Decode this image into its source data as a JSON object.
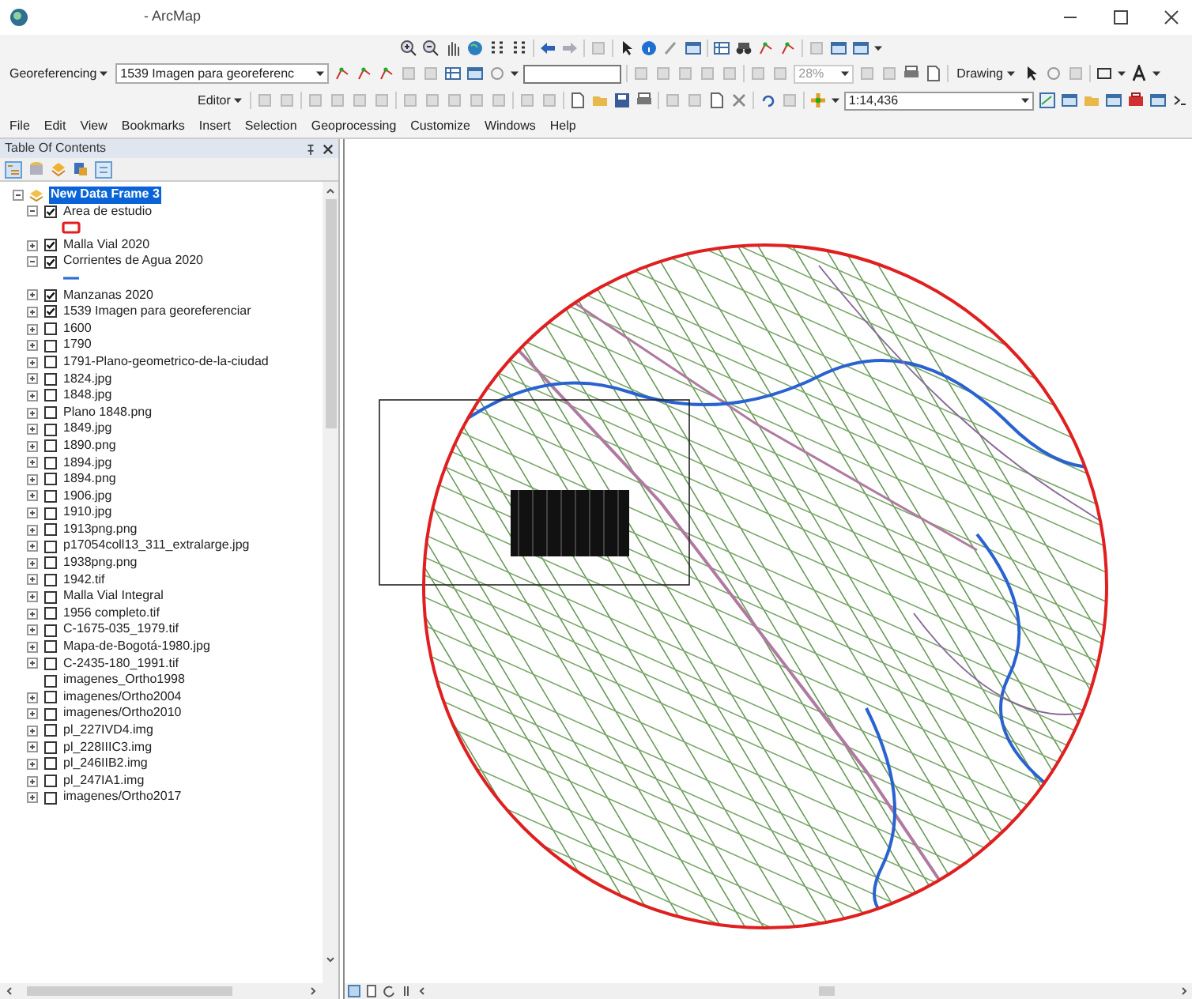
{
  "window": {
    "title": "- ArcMap"
  },
  "toolbars": {
    "georeferencing": {
      "label": "Georeferencing",
      "layer": "1539 Imagen para georeferenc",
      "zoom": "28%"
    },
    "drawing": {
      "label": "Drawing"
    },
    "editor": {
      "label": "Editor"
    },
    "scale": "1:14,436"
  },
  "menu": [
    "File",
    "Edit",
    "View",
    "Bookmarks",
    "Insert",
    "Selection",
    "Geoprocessing",
    "Customize",
    "Windows",
    "Help"
  ],
  "toc": {
    "title": "Table Of Contents",
    "data_frame": {
      "label": "New Data Frame 3",
      "selected": true,
      "expanded": true
    },
    "layers": [
      {
        "label": "Area de estudio",
        "checked": true,
        "expanded": true,
        "legend": {
          "kind": "outline",
          "color": "#e02020"
        }
      },
      {
        "label": "Malla Vial 2020",
        "checked": true,
        "expanded": false
      },
      {
        "label": "Corrientes de Agua 2020",
        "checked": true,
        "expanded": true,
        "legend": {
          "kind": "line",
          "color": "#2a6fd6"
        }
      },
      {
        "label": "Manzanas 2020",
        "checked": true,
        "expanded": false
      },
      {
        "label": "1539 Imagen para georeferenciar",
        "checked": true,
        "expanded": false
      },
      {
        "label": "1600",
        "checked": false,
        "expanded": false
      },
      {
        "label": "1790",
        "checked": false,
        "expanded": false
      },
      {
        "label": "1791-Plano-geometrico-de-la-ciudad",
        "checked": false,
        "expanded": false
      },
      {
        "label": "1824.jpg",
        "checked": false,
        "expanded": false
      },
      {
        "label": "1848.jpg",
        "checked": false,
        "expanded": false
      },
      {
        "label": "Plano 1848.png",
        "checked": false,
        "expanded": false
      },
      {
        "label": "1849.jpg",
        "checked": false,
        "expanded": false
      },
      {
        "label": "1890.png",
        "checked": false,
        "expanded": false
      },
      {
        "label": "1894.jpg",
        "checked": false,
        "expanded": false
      },
      {
        "label": "1894.png",
        "checked": false,
        "expanded": false
      },
      {
        "label": "1906.jpg",
        "checked": false,
        "expanded": false
      },
      {
        "label": "1910.jpg",
        "checked": false,
        "expanded": false
      },
      {
        "label": "1913png.png",
        "checked": false,
        "expanded": false
      },
      {
        "label": "p17054coll13_311_extralarge.jpg",
        "checked": false,
        "expanded": false
      },
      {
        "label": "1938png.png",
        "checked": false,
        "expanded": false
      },
      {
        "label": "1942.tif",
        "checked": false,
        "expanded": false
      },
      {
        "label": "Malla Vial Integral",
        "checked": false,
        "expanded": false
      },
      {
        "label": "1956 completo.tif",
        "checked": false,
        "expanded": false
      },
      {
        "label": "C-1675-035_1979.tif",
        "checked": false,
        "expanded": false
      },
      {
        "label": "Mapa-de-Bogotá-1980.jpg",
        "checked": false,
        "expanded": false
      },
      {
        "label": "C-2435-180_1991.tif",
        "checked": false,
        "expanded": false
      },
      {
        "label": "imagenes_Ortho1998",
        "checked": false
      },
      {
        "label": "imagenes/Ortho2004",
        "checked": false,
        "expanded": false
      },
      {
        "label": "imagenes/Ortho2010",
        "checked": false,
        "expanded": false
      },
      {
        "label": "pl_227IVD4.img",
        "checked": false,
        "expanded": false
      },
      {
        "label": "pl_228IIIC3.img",
        "checked": false,
        "expanded": false
      },
      {
        "label": "pl_246IIB2.img",
        "checked": false,
        "expanded": false
      },
      {
        "label": "pl_247IA1.img",
        "checked": false,
        "expanded": false
      },
      {
        "label": "imagenes/Ortho2017",
        "checked": false,
        "expanded": false
      }
    ]
  }
}
